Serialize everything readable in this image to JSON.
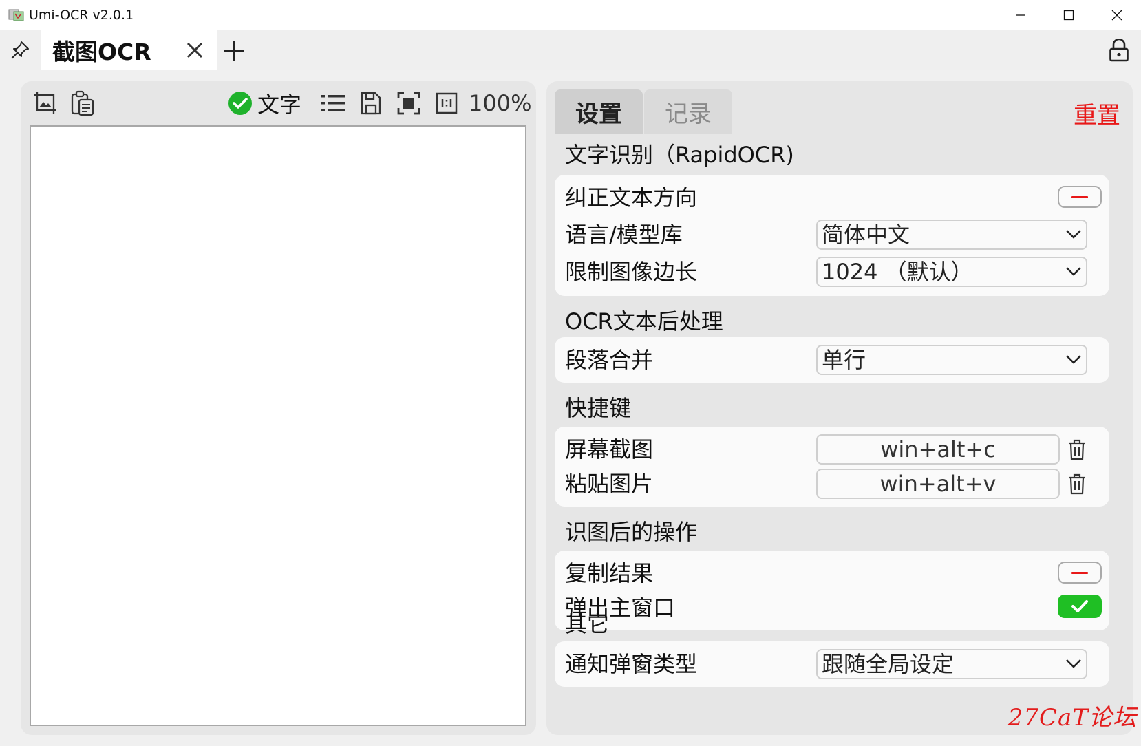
{
  "window": {
    "title": "Umi-OCR v2.0.1",
    "icons": [
      "app-icon",
      "minimize-icon",
      "maximize-icon",
      "close-icon"
    ]
  },
  "tabbar": {
    "active_tab": "截图OCR",
    "icons": [
      "pin-icon",
      "tab-close-icon",
      "add-tab-icon",
      "lock-icon"
    ]
  },
  "left_toolbar": {
    "icons": [
      "screenshot-image-icon",
      "clipboard-paste-icon",
      "check-circle-icon",
      "list-icon",
      "save-icon",
      "fit-screen-icon",
      "actual-size-icon"
    ],
    "text_toggle_label": "文字",
    "text_toggle_checked": true,
    "zoom_label": "100%"
  },
  "right_panel": {
    "tabs": [
      "设置",
      "记录"
    ],
    "active_tab": "设置",
    "reset_label": "重置",
    "sections": {
      "ocr": {
        "title": "文字识别（RapidOCR)",
        "rows": {
          "correct_direction": {
            "label": "纠正文本方向",
            "enabled": false
          },
          "language": {
            "label": "语言/模型库",
            "value": "简体中文"
          },
          "limit_side": {
            "label": "限制图像边长",
            "value": "1024 （默认）"
          }
        }
      },
      "postprocess": {
        "title": "OCR文本后处理",
        "rows": {
          "paragraph": {
            "label": "段落合并",
            "value": "单行"
          }
        }
      },
      "hotkeys": {
        "title": "快捷键",
        "rows": {
          "screenshot": {
            "label": "屏幕截图",
            "value": "win+alt+c"
          },
          "paste": {
            "label": "粘贴图片",
            "value": "win+alt+v"
          }
        }
      },
      "after_ocr": {
        "title": "识图后的操作",
        "rows": {
          "copy_result": {
            "label": "复制结果",
            "enabled": false
          },
          "popup_main": {
            "label": "弹出主窗口",
            "enabled": true
          }
        }
      },
      "other": {
        "title": "其它",
        "rows": {
          "notify_type": {
            "label": "通知弹窗类型",
            "value": "跟随全局设定"
          }
        }
      }
    }
  },
  "watermark": "27CaT论坛",
  "colors": {
    "accent_green": "#1fbf24",
    "reset_red": "#e81818",
    "panel_bg": "#e6e6e6",
    "group_bg": "#fafafa"
  }
}
